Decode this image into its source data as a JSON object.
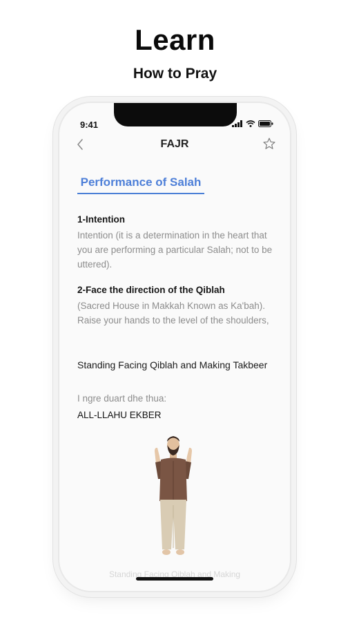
{
  "promo": {
    "headline": "Learn",
    "subheadline": "How to Pray"
  },
  "status_bar": {
    "time": "9:41",
    "icons": [
      "signal-icon",
      "wifi-icon",
      "battery-icon"
    ]
  },
  "nav": {
    "title": "FAJR",
    "back_icon": "chevron-left-icon",
    "favorite_icon": "star-outline-icon"
  },
  "tab": {
    "label": "Performance of Salah",
    "color": "#4d7fd8"
  },
  "sections": [
    {
      "title": "1-Intention",
      "body": "Intention (it is a determination in the heart that you are performing a particular Salah; not to be uttered)."
    },
    {
      "title": "2-Face the direction of the Qiblah",
      "body": "(Sacred House in Makkah Known as Ka'bah). Raise your hands to the level of the shoulders,"
    }
  ],
  "step": {
    "caption": "Standing Facing Qiblah and Making Takbeer",
    "recite_label": "I ngre duart dhe thua:",
    "recite_text": "ALL-LLAHU EKBER"
  },
  "faded_caption": "Standing Facing Qiblah and Making"
}
